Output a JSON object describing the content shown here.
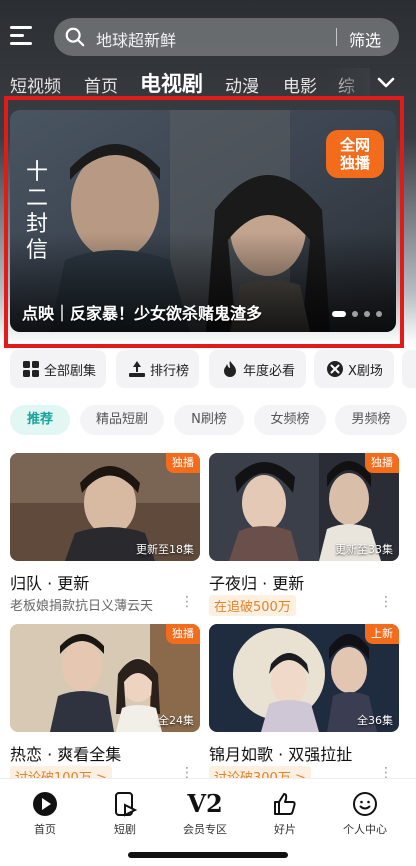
{
  "header": {
    "search_placeholder": "地球超新鲜",
    "filter_label": "筛选"
  },
  "tabs": [
    "短视频",
    "首页",
    "电视剧",
    "动漫",
    "电影",
    "综"
  ],
  "active_tab_index": 2,
  "banner": {
    "caption": "点映｜反家暴！少女欲杀赌鬼渣多",
    "badge": "全网独播",
    "badge_line1": "全网",
    "badge_line2": "独播",
    "vertical_title": "十二封信"
  },
  "quick_links": [
    {
      "label": "全部剧集",
      "icon": "grid-icon"
    },
    {
      "label": "排行榜",
      "icon": "ranking-icon"
    },
    {
      "label": "年度必看",
      "icon": "flame-icon"
    },
    {
      "label": "X剧场",
      "icon": "x-theater-icon"
    }
  ],
  "pills": [
    "推荐",
    "精品短剧",
    "N刷榜",
    "女频榜",
    "男频榜"
  ],
  "cards": [
    {
      "title": "归队 · 更新",
      "subtitle": "老板娘捐款抗日义薄云天",
      "tag": "独播",
      "episodes": "更新至18集",
      "sub_highlight": false
    },
    {
      "title": "子夜归 · 更新",
      "subtitle": "在追破500万",
      "tag": "独播",
      "episodes": "更新至33集",
      "sub_highlight": true
    },
    {
      "title": "热恋 · 爽看全集",
      "subtitle": "讨论破100万 >",
      "tag": "独播",
      "episodes": "全24集",
      "sub_highlight": true
    },
    {
      "title": "锦月如歌 · 双强拉扯",
      "subtitle": "讨论破300万 >",
      "tag": "上新",
      "episodes": "全36集",
      "sub_highlight": true
    }
  ],
  "bottom_nav": [
    {
      "label": "首页",
      "icon": "home-play-icon"
    },
    {
      "label": "短剧",
      "icon": "short-drama-icon"
    },
    {
      "label": "会员专区",
      "icon": "vip-icon",
      "glyph": "V2"
    },
    {
      "label": "好片",
      "icon": "thumbs-up-icon"
    },
    {
      "label": "个人中心",
      "icon": "profile-icon"
    }
  ],
  "colors": {
    "accent_orange": "#f36c1c",
    "accent_teal": "#16a39a",
    "highlight_frame": "#e11a1a"
  }
}
